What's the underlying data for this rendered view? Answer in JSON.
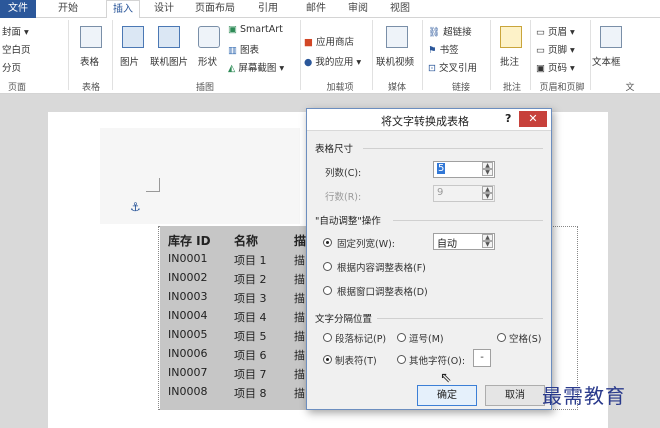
{
  "ribbon": {
    "tabs": [
      "文件",
      "开始",
      "插入",
      "设计",
      "页面布局",
      "引用",
      "邮件",
      "审阅",
      "视图"
    ],
    "active_tab": "插入",
    "pages_group": {
      "items": [
        "封面 ▾",
        "空白页",
        "分页"
      ],
      "label": "页面"
    },
    "tables_group": {
      "button": "表格",
      "label": "表格"
    },
    "illustrations_group": {
      "picture": "图片",
      "online_picture": "联机图片",
      "shapes": "形状",
      "smartart": "SmartArt",
      "chart": "图表",
      "screenshot": "屏幕截图 ▾",
      "label": "插图"
    },
    "addins_group": {
      "store": "应用商店",
      "my_apps": "我的应用 ▾",
      "label": "加载项"
    },
    "media_group": {
      "online_video": "联机视频",
      "label": "媒体"
    },
    "links_group": {
      "hyperlink": "超链接",
      "bookmark": "书签",
      "crossref": "交叉引用",
      "label": "链接"
    },
    "comments_group": {
      "comment": "批注",
      "label": "批注"
    },
    "header_footer_group": {
      "header": "页眉 ▾",
      "footer": "页脚 ▾",
      "page_number": "页码 ▾",
      "label": "页眉和页脚"
    },
    "text_group": {
      "textbox": "文本框",
      "label": "文"
    }
  },
  "document": {
    "table_header": [
      "库存 ID",
      "名称",
      "描"
    ],
    "rows": [
      [
        "IN0001",
        "项目 1",
        "描"
      ],
      [
        "IN0002",
        "项目 2",
        "描"
      ],
      [
        "IN0003",
        "项目 3",
        "描"
      ],
      [
        "IN0004",
        "项目 4",
        "描"
      ],
      [
        "IN0005",
        "项目 5",
        "描"
      ],
      [
        "IN0006",
        "项目 6",
        "描"
      ],
      [
        "IN0007",
        "项目 7",
        "描"
      ],
      [
        "IN0008",
        "项目 8",
        "描"
      ]
    ]
  },
  "dialog": {
    "title": "将文字转换成表格",
    "help": "?",
    "close": "✕",
    "table_size": {
      "section": "表格尺寸",
      "columns_label": "列数(C):",
      "columns_value": "5",
      "rows_label": "行数(R):",
      "rows_value": "9"
    },
    "autofit": {
      "section": "\"自动调整\"操作",
      "fixed_width_label": "固定列宽(W):",
      "fixed_width_value": "自动",
      "fit_contents_label": "根据内容调整表格(F)",
      "fit_window_label": "根据窗口调整表格(D)",
      "selected": "fixed_width"
    },
    "separator": {
      "section": "文字分隔位置",
      "paragraph": "段落标记(P)",
      "comma": "逗号(M)",
      "space": "空格(S)",
      "tab": "制表符(T)",
      "other": "其他字符(O):",
      "other_value": "-",
      "selected": "tab"
    },
    "ok": "确定",
    "cancel": "取消"
  },
  "watermark": "最需教育"
}
